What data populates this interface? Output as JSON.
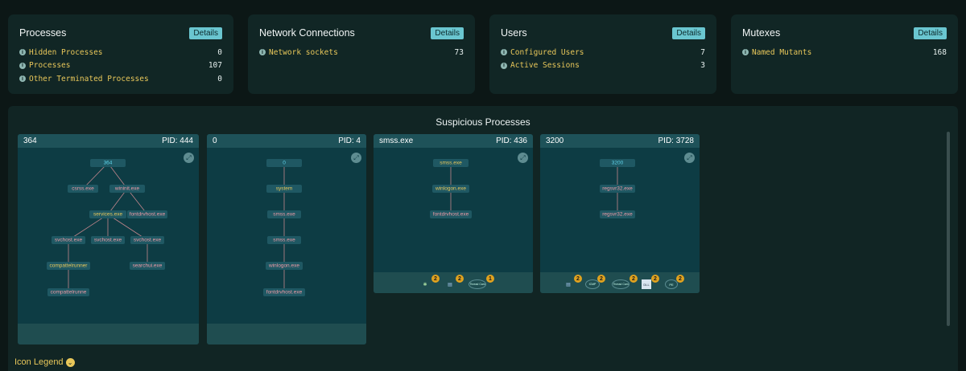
{
  "cards": [
    {
      "title": "Processes",
      "details": "Details",
      "rows": [
        {
          "label": "Hidden Processes",
          "value": "0"
        },
        {
          "label": "Processes",
          "value": "107"
        },
        {
          "label": "Other Terminated Processes",
          "value": "0"
        }
      ]
    },
    {
      "title": "Network Connections",
      "details": "Details",
      "rows": [
        {
          "label": "Network sockets",
          "value": "73"
        }
      ]
    },
    {
      "title": "Users",
      "details": "Details",
      "rows": [
        {
          "label": "Configured Users",
          "value": "7"
        },
        {
          "label": "Active Sessions",
          "value": "3"
        }
      ]
    },
    {
      "title": "Mutexes",
      "details": "Details",
      "rows": [
        {
          "label": "Named Mutants",
          "value": "168"
        }
      ]
    }
  ],
  "suspicious": {
    "title": "Suspicious Processes",
    "processes": [
      {
        "name": "364",
        "pid": "PID: 444"
      },
      {
        "name": "0",
        "pid": "PID: 4"
      },
      {
        "name": "smss.exe",
        "pid": "PID: 436"
      },
      {
        "name": "3200",
        "pid": "PID: 3728"
      }
    ]
  },
  "trees": {
    "t0": {
      "n0": "364",
      "n1": "csrss.exe",
      "n2": "wininit.exe",
      "n3": "services.exe",
      "n4": "fontdrvhost.exe",
      "n5": "svchost.exe",
      "n6": "svchost.exe",
      "n7": "svchost.exe",
      "n8": "compattelrunner",
      "n9": "searchui.exe",
      "n10": "compattelrunne"
    },
    "t1": {
      "n0": "0",
      "n1": "system",
      "n2": "smss.exe",
      "n3": "smss.exe",
      "n4": "winlogon.exe",
      "n5": "fontdrvhost.exe"
    },
    "t2": {
      "n0": "smss.exe",
      "n1": "winlogon.exe",
      "n2": "fontdrvhost.exe"
    },
    "t3": {
      "n0": "3200",
      "n1": "regsvr32.exe",
      "n2": "regsvr32.exe"
    }
  },
  "footers": {
    "f2": [
      {
        "icon": "bug-icon",
        "glyph": "✱",
        "count": "2"
      },
      {
        "icon": "file-icon",
        "glyph": "▤",
        "count": "2"
      },
      {
        "icon": "thread-icon",
        "glyph": "Thread Cam",
        "count": "1"
      }
    ],
    "f3": [
      {
        "icon": "file-icon",
        "glyph": "▤",
        "count": "2"
      },
      {
        "icon": "icmp-icon",
        "glyph": "ICMP",
        "count": "2"
      },
      {
        "icon": "thread-icon",
        "glyph": "Thread Cam",
        "count": "2"
      },
      {
        "icon": "dll-icon",
        "glyph": "DLL",
        "count": "2"
      },
      {
        "icon": "pe-icon",
        "glyph": "PE",
        "count": "2"
      }
    ]
  },
  "legend": {
    "label": "Icon Legend",
    "chevron": "⌄"
  },
  "icons": {
    "info": "i",
    "expand": "⤢"
  },
  "colors": {
    "accent": "#6ac6d0",
    "link": "#e8c75a",
    "badge": "#e0a21f",
    "panel": "#0d3c44"
  }
}
